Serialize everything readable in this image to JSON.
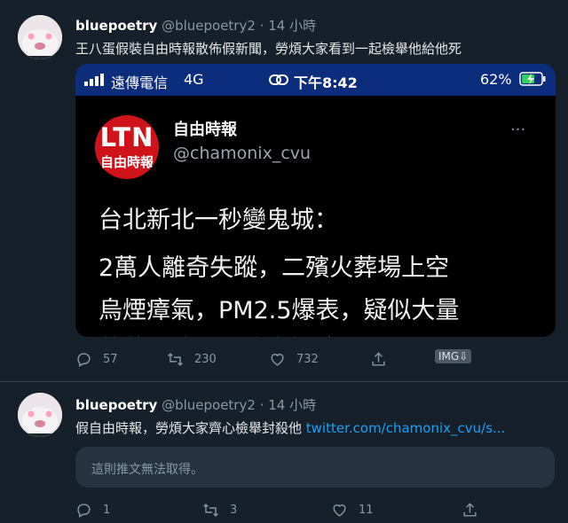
{
  "tweet1": {
    "name": "bluepoetry",
    "handle": "@bluepoetry2",
    "time": "14 小時",
    "text": "王八蛋假裝自由時報散佈假新聞，勞煩大家看到一起檢舉他給他死",
    "actions": {
      "reply": "57",
      "retweet": "230",
      "like": "732",
      "img_badge": "IMG⇩"
    },
    "embed": {
      "carrier": "遠傳電信",
      "network": "4G",
      "clock": "下午8:42",
      "battery": "62%",
      "account_name": "自由時報",
      "account_handle": "@chamonix_cvu",
      "logo_top": "LTN",
      "logo_bottom": "自由時報",
      "more": "···",
      "lines": [
        "台北新北一秒變鬼城：",
        "2萬人離奇失蹤，二殯火葬場上空",
        "烏煙瘴氣，PM2.5爆表，疑似大量",
        "萬萬時消過購值大持境"
      ]
    }
  },
  "tweet2": {
    "name": "bluepoetry",
    "handle": "@bluepoetry2",
    "time": "14 小時",
    "text": "假自由時報，勞煩大家齊心檢舉封殺他 ",
    "link": "twitter.com/chamonix_cvu/s...",
    "unavailable": "這則推文無法取得。",
    "actions": {
      "reply": "1",
      "retweet": "3",
      "like": "11"
    }
  }
}
